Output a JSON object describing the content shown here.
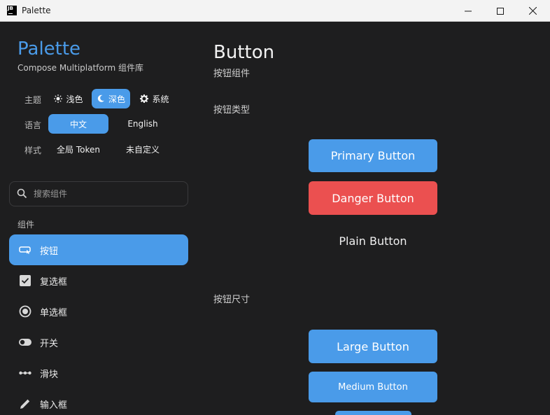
{
  "window": {
    "icon_text": "JB",
    "title": "Palette"
  },
  "sidebar": {
    "app_title": "Palette",
    "app_subtitle": "Compose Multiplatform 组件库",
    "theme": {
      "label": "主题",
      "options": [
        {
          "label": "浅色",
          "icon": "sun-icon",
          "active": false
        },
        {
          "label": "深色",
          "icon": "moon-icon",
          "active": true
        },
        {
          "label": "系统",
          "icon": "gear-icon",
          "active": false
        }
      ]
    },
    "language": {
      "label": "语言",
      "options": [
        {
          "label": "中文",
          "active": true
        },
        {
          "label": "English",
          "active": false
        }
      ]
    },
    "style": {
      "label": "样式",
      "options": [
        {
          "label": "全局 Token",
          "active": false
        },
        {
          "label": "未自定义",
          "active": false
        }
      ]
    },
    "search": {
      "placeholder": "搜索组件"
    },
    "section_label": "组件",
    "nav": [
      {
        "label": "按钮",
        "icon": "button-icon",
        "active": true
      },
      {
        "label": "复选框",
        "icon": "checkbox-icon",
        "active": false
      },
      {
        "label": "单选框",
        "icon": "radio-icon",
        "active": false
      },
      {
        "label": "开关",
        "icon": "toggle-icon",
        "active": false
      },
      {
        "label": "滑块",
        "icon": "slider-icon",
        "active": false
      },
      {
        "label": "输入框",
        "icon": "pencil-icon",
        "active": false
      }
    ]
  },
  "main": {
    "title": "Button",
    "subtitle": "按钮组件",
    "types_title": "按钮类型",
    "sizes_title": "按钮尺寸",
    "buttons": {
      "primary": "Primary Button",
      "danger": "Danger Button",
      "plain": "Plain Button",
      "large": "Large Button",
      "medium": "Medium Button"
    }
  },
  "colors": {
    "accent": "#4a9be9",
    "danger": "#eb5050",
    "background": "#1e1e1f"
  }
}
